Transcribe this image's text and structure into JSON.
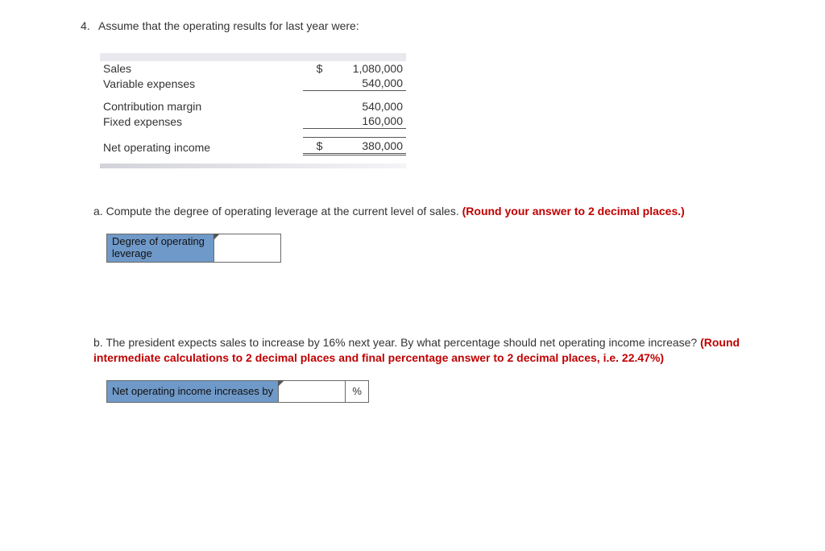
{
  "question": {
    "number": "4.",
    "text": "Assume that the operating results for last year were:"
  },
  "fin": {
    "sales_label": "Sales",
    "sales_cur": "$",
    "sales_val": "1,080,000",
    "varexp_label": "Variable expenses",
    "varexp_val": "540,000",
    "cm_label": "Contribution margin",
    "cm_val": "540,000",
    "fixed_label": "Fixed expenses",
    "fixed_val": "160,000",
    "noi_label": "Net operating income",
    "noi_cur": "$",
    "noi_val": "380,000"
  },
  "partA": {
    "letter": "a.",
    "text": "Compute the degree of operating leverage at the current level of sales.",
    "hint": "(Round your answer to 2 decimal places.)",
    "box_label_l1": "Degree of operating",
    "box_label_l2": "leverage"
  },
  "partB": {
    "letter": "b.",
    "text": "The president expects sales to increase by 16% next year. By what percentage should net operating income increase?",
    "hint": "(Round intermediate calculations to 2 decimal places and final percentage answer to 2 decimal places, i.e. 22.47%)",
    "box_label": "Net operating income increases by",
    "unit": "%"
  }
}
